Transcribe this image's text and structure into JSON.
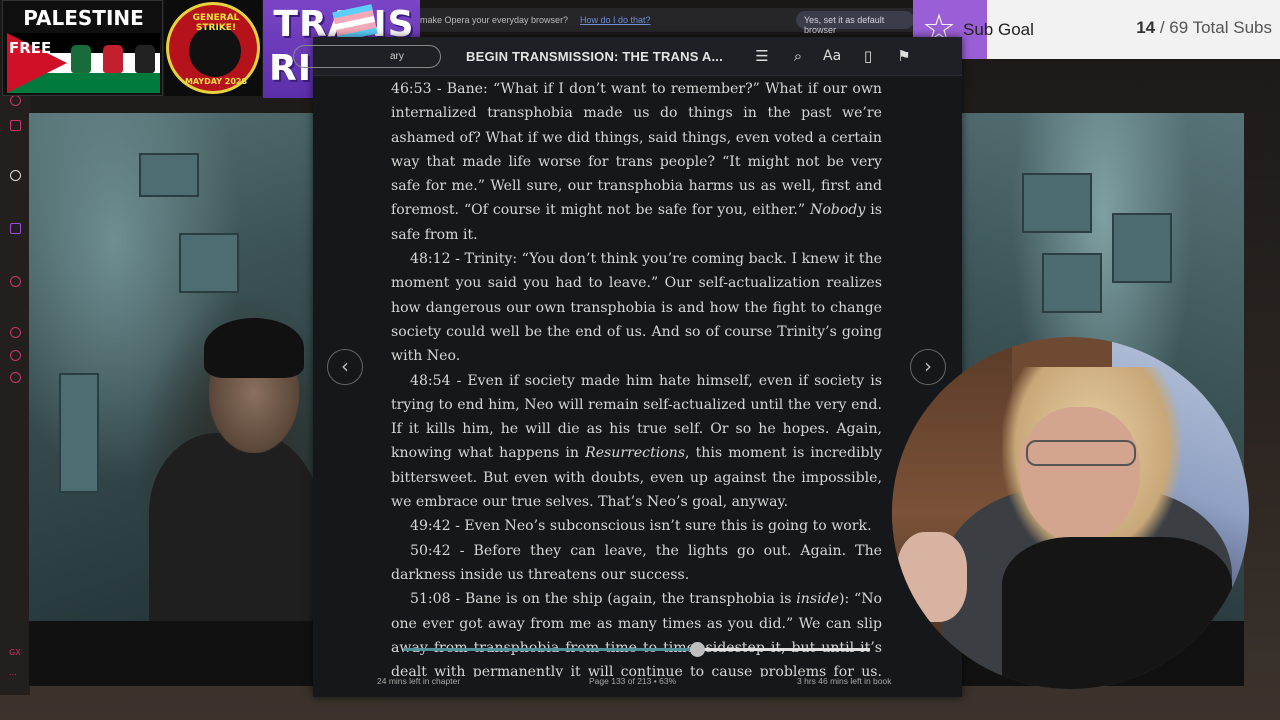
{
  "badges": {
    "palestine": {
      "title": "PALESTINE",
      "free": "FREE"
    },
    "strike": {
      "top": "GENERAL STRIKE!",
      "bottom": "MAYDAY 2028"
    },
    "trans": {
      "line1": "TRANS",
      "line2": "RIGHTS"
    }
  },
  "opera": {
    "message": "make Opera your everyday browser?",
    "link": "How do I do that?",
    "button": "Yes, set it as default browser"
  },
  "subgoal": {
    "label": "Sub Goal",
    "current": "14",
    "separator": " / ",
    "target": "69 Total Subs"
  },
  "reader": {
    "library_label": "ary",
    "book_title": "BEGIN TRANSMISSION: THE TRANS A...",
    "icons": [
      "toc-icon",
      "search-icon",
      "font-settings-icon",
      "notes-icon",
      "bookmark-icon"
    ],
    "font_icon_text": "Aa",
    "paragraphs": [
      "46:53 - Bane: “What if I don’t want to remember?” What if our own internalized transphobia made us do things in the past we’re ashamed of? What if we did things, said things, even voted a certain way that made life worse for trans people? “It might not be very safe for me.” Well sure, our transphobia harms us as well, first and foremost. “Of course it might not be safe for you, either.”",
      "48:12 - Trinity: “You don’t think you’re coming back. I knew it the moment you said you had to leave.” Our self-actualization realizes how dangerous our own transphobia is and how the fight to change society could well be the end of us. And so of course Trinity’s going with Neo.",
      "48:54 - Even if society made him hate himself, even if society is trying to end him, Neo will remain self-actualized until the very end. If it kills him, he will die as his true self. Or so he hopes. Again, knowing what happens in",
      "49:42 - Even Neo’s subconscious isn’t sure this is going to work.",
      "50:42 - Before they can leave, the lights go out. Again. The darkness inside us threatens our success.",
      "51:08 - Bane is on the ship (again, the transphobia is"
    ],
    "p1_italic": "Nobody",
    "p1_tail": " is safe from it.",
    "p3_italic": "Resurrections",
    "p3_tail": ", this moment is incredibly bittersweet. But even with doubts, even up against the impossible, we embrace our true selves. That’s Neo’s goal, anyway.",
    "p6_italic": "inside",
    "p6_tail": "): “No one ever got away from me as many times as you did.” We can slip away from transphobia from time to time, sidestep it, but until it’s dealt with permanently it will continue to cause problems for us. Some",
    "progress_fraction": 0.63,
    "footer": {
      "chapter_left": "24 mins left in chapter",
      "page_info": "Page 133 of 213",
      "bullet": "•",
      "percent": "63%",
      "book_left": "3 hrs 46 mins left in book"
    }
  },
  "rail": {
    "bottom_label": "GX",
    "dots": "..."
  },
  "colors": {
    "rail_accent": "#c9366a",
    "subgoal_purple": "#9a5fd6",
    "progress_fill": "#4f8f9c",
    "reader_bg": "#16171b"
  }
}
